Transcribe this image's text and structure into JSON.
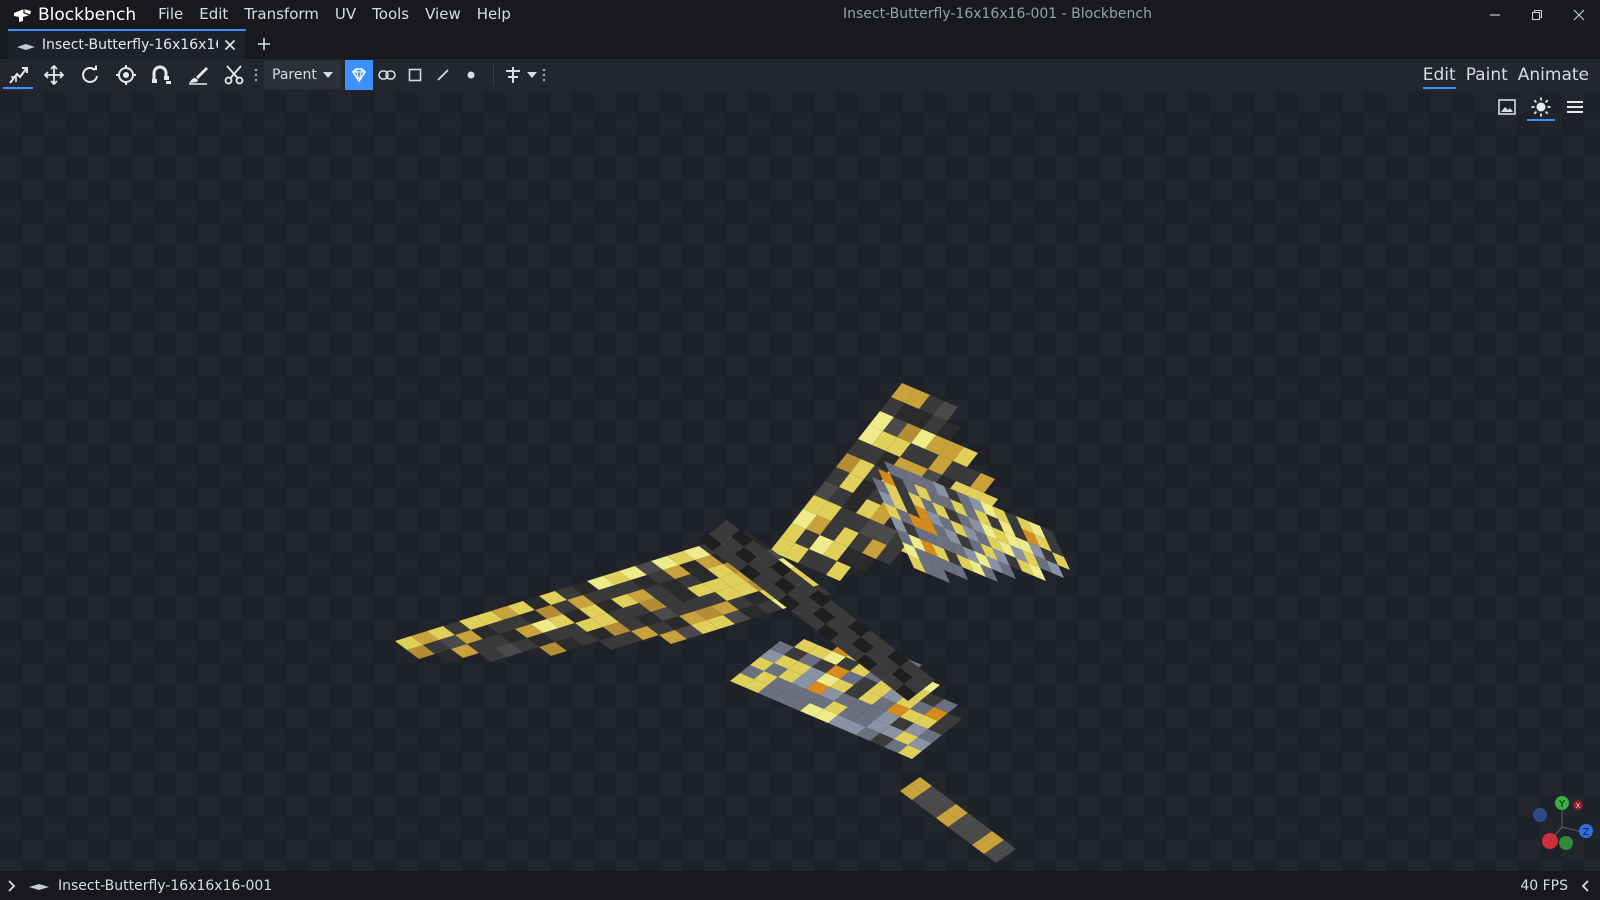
{
  "app": {
    "name": "Blockbench",
    "window_title": "Insect-Butterfly-16x16x16-001 - Blockbench"
  },
  "menu": [
    "File",
    "Edit",
    "Transform",
    "UV",
    "Tools",
    "View",
    "Help"
  ],
  "tabs": [
    {
      "label": "Insect-Butterfly-16x16x16-001",
      "icon": "blockbench-model-icon"
    }
  ],
  "toolbar": {
    "tools": [
      {
        "icon": "move-pivot-icon",
        "active": true
      },
      {
        "icon": "move-icon",
        "active": false
      },
      {
        "icon": "rotate-icon",
        "active": false
      },
      {
        "icon": "pivot-icon",
        "active": false
      },
      {
        "icon": "vertex-snap-icon",
        "active": false
      },
      {
        "icon": "brush-icon",
        "active": false
      },
      {
        "icon": "scissors-icon",
        "active": false
      }
    ],
    "transform_space": "Parent",
    "selection_modes": [
      "object-mode-icon",
      "link-icon",
      "face-icon",
      "edge-icon",
      "vertex-icon"
    ],
    "selected_selection_mode": "object-mode-icon"
  },
  "modes": [
    {
      "label": "Edit",
      "active": true
    },
    {
      "label": "Paint",
      "active": false
    },
    {
      "label": "Animate",
      "active": false
    }
  ],
  "viewport": {
    "controls": [
      "image-icon",
      "lighting-icon",
      "menu-icon"
    ],
    "gizmo_axes": [
      "X",
      "Y",
      "Z"
    ],
    "accent_color": "#3e90ff"
  },
  "status": {
    "model_name": "Insect-Butterfly-16x16x16-001",
    "fps": "40 FPS"
  }
}
